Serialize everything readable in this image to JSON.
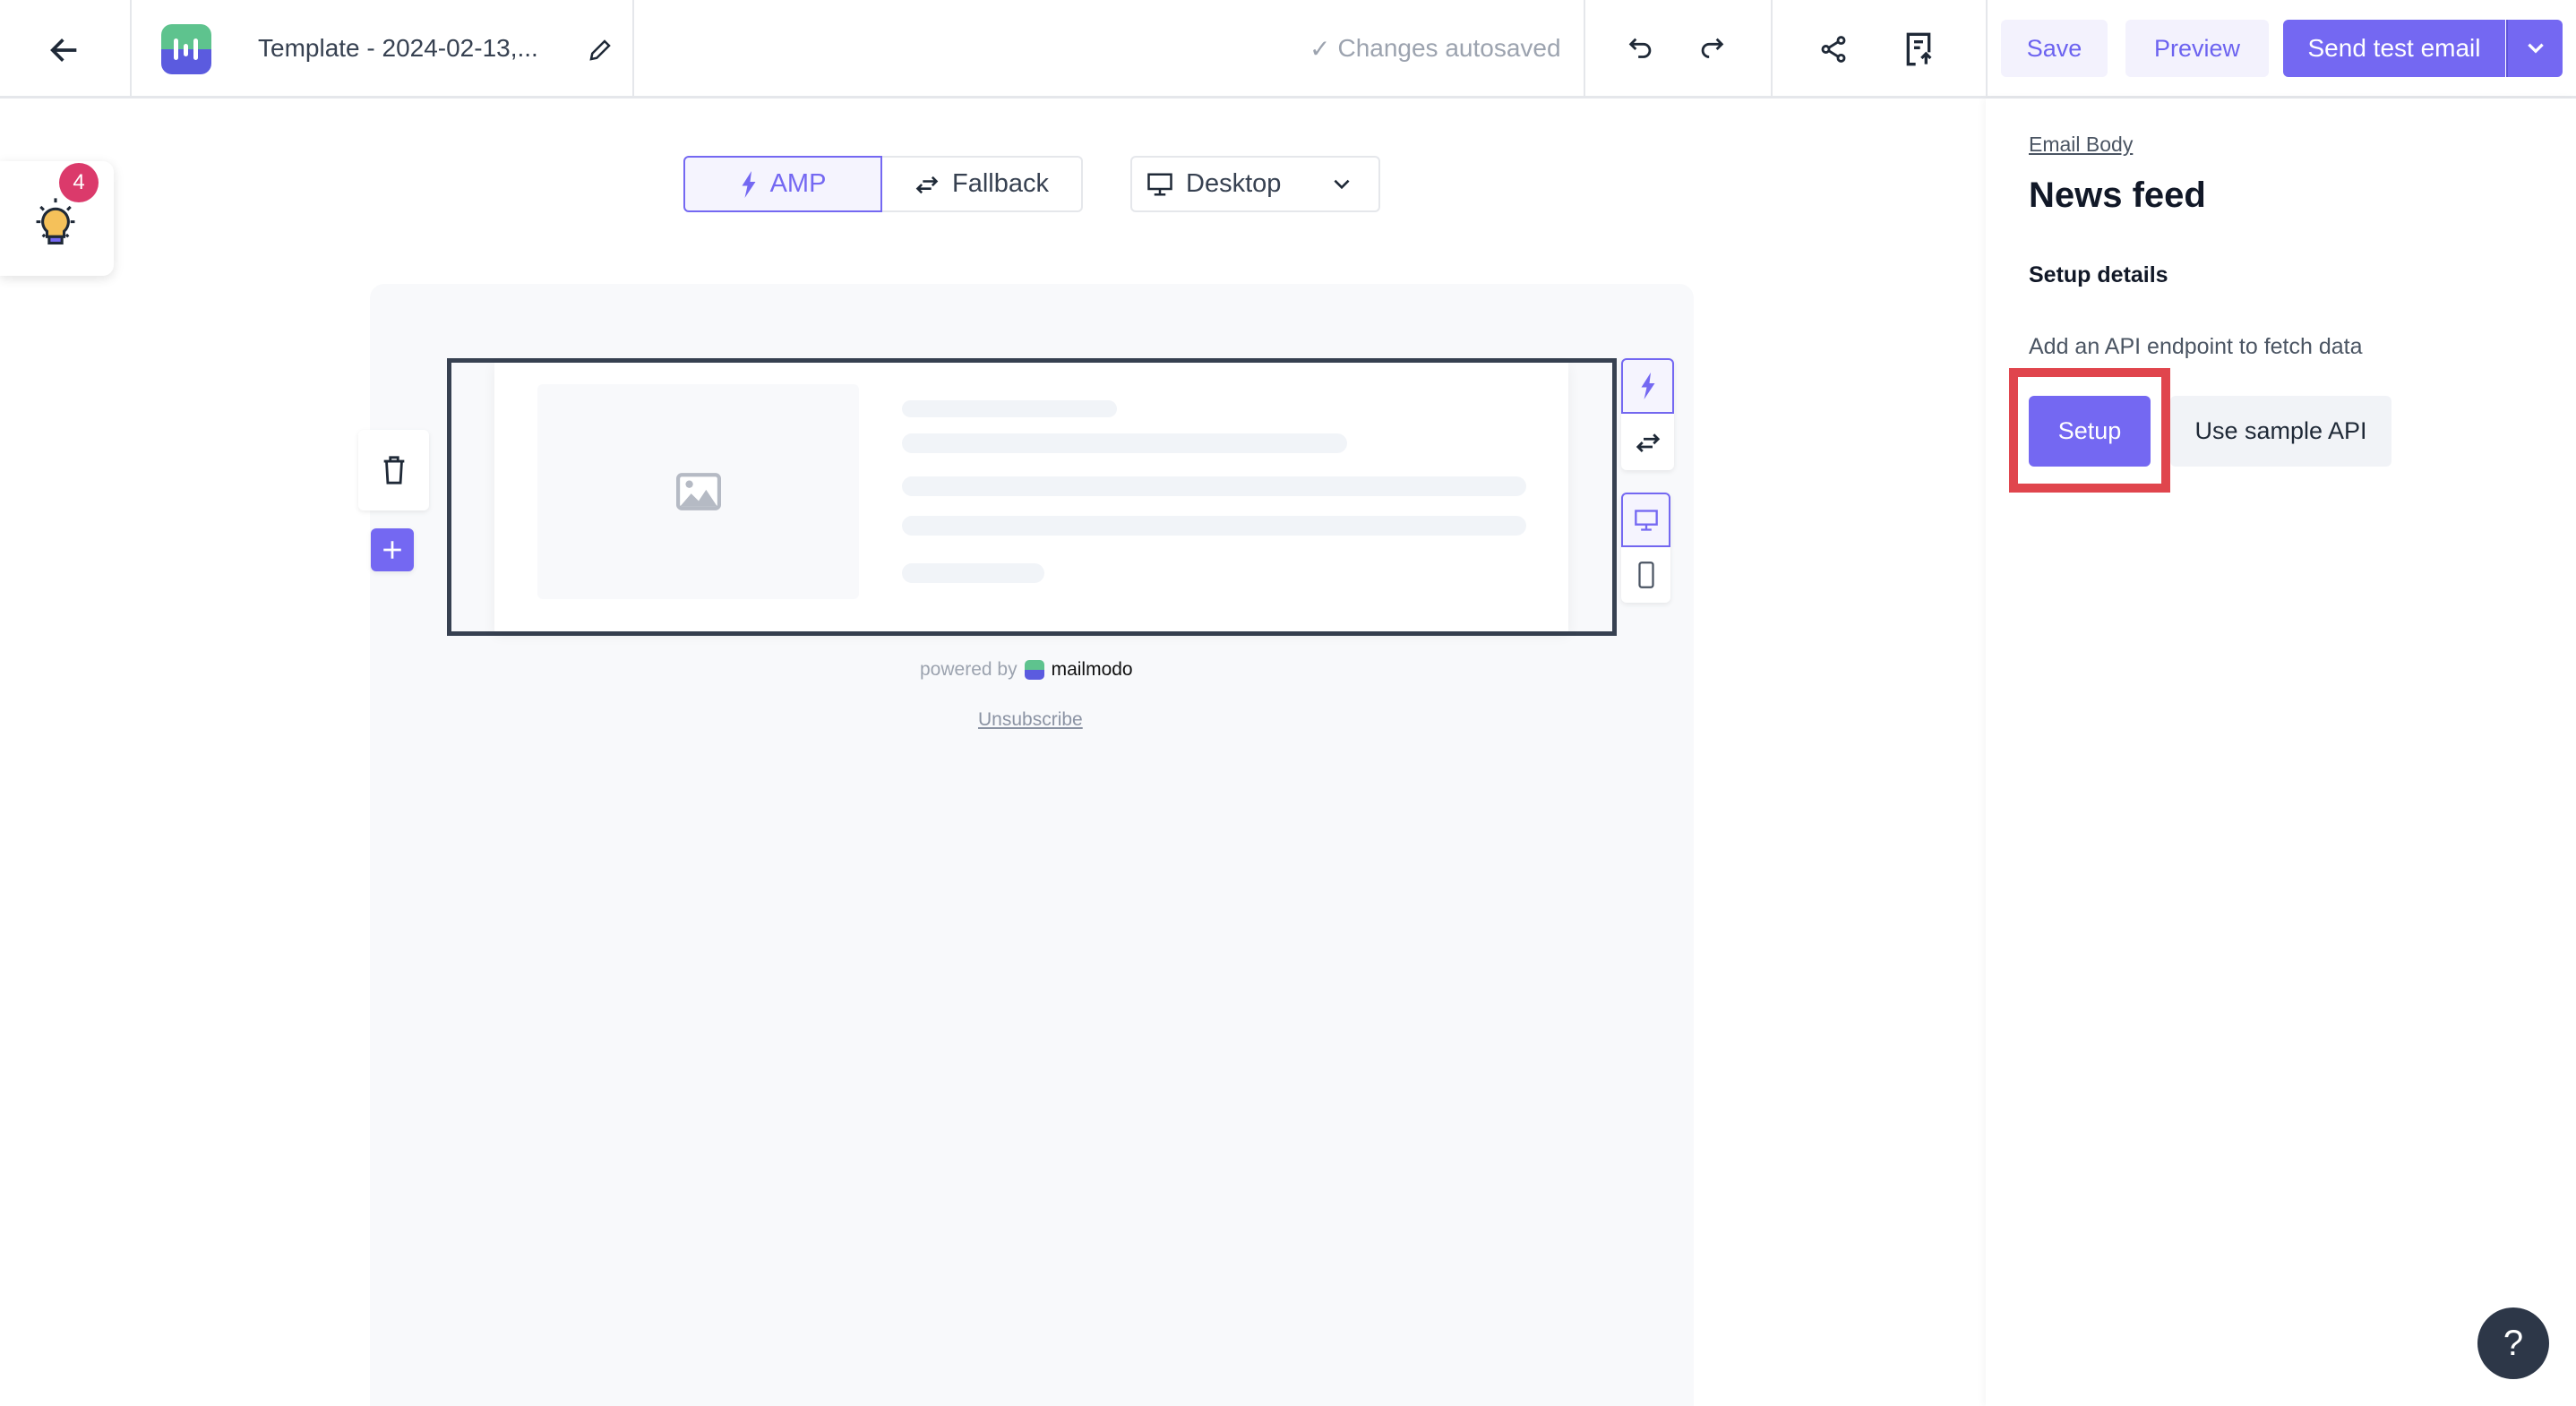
{
  "header": {
    "title": "Template - 2024-02-13,...",
    "autosave_status": "Changes autosaved",
    "save_label": "Save",
    "preview_label": "Preview",
    "send_test_label": "Send test email"
  },
  "tips": {
    "badge_count": "4"
  },
  "mode_toggle": {
    "amp_label": "AMP",
    "fallback_label": "Fallback",
    "selected": "AMP"
  },
  "device_select": {
    "value": "Desktop"
  },
  "canvas": {
    "powered_by": "powered by",
    "brand": "mailmodo",
    "unsubscribe": "Unsubscribe"
  },
  "panel": {
    "breadcrumb": "Email Body",
    "title": "News feed",
    "section": "Setup details",
    "description": "Add an API endpoint to fetch data",
    "setup_label": "Setup",
    "sample_label": "Use sample API"
  },
  "colors": {
    "accent": "#7468f2",
    "highlight": "#e0454d",
    "badge": "#db3a6b"
  }
}
